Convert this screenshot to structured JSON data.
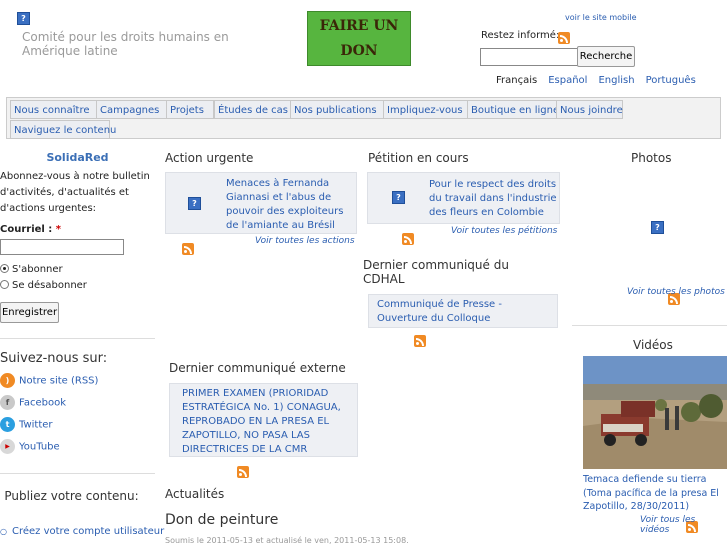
{
  "header": {
    "site_name": "Comité pour les droits humains en Amérique latine",
    "donate_line1": "FAIRE UN",
    "donate_line2": "DON",
    "mobile_link": "voir le site mobile",
    "inform_label": "Restez informé:",
    "search_button": "Recherche",
    "languages": [
      "Français",
      "Español",
      "English",
      "Português"
    ]
  },
  "nav": [
    "Nous connaître",
    "Campagnes",
    "Projets",
    "Études de cas",
    "Nos publications",
    "Impliquez-vous",
    "Boutique en ligne",
    "Nous joindre",
    "Naviguez le contenu"
  ],
  "left": {
    "title": "SolidaRed",
    "intro": "Abonnez-vous à notre bulletin d'activités, d'actualités et d'actions urgentes:",
    "email_label": "Courriel :",
    "required_mark": "*",
    "subscribe": "S'abonner",
    "unsubscribe": "Se désabonner",
    "register": "Enregistrer",
    "follow_title": "Suivez-nous sur:",
    "social": [
      "Notre site (RSS)",
      "Facebook",
      "Twitter",
      "YouTube"
    ],
    "publish_title": "Publiez votre contenu:",
    "publish_item": "Créez votre compte utilisateur"
  },
  "urgent": {
    "title": "Action urgente",
    "item": "Menaces à Fernanda Giannasi et l'abus de pouvoir des exploiteurs de l'amiante au Brésil",
    "see_all": "Voir toutes les actions"
  },
  "petition": {
    "title": "Pétition en cours",
    "item": "Pour le respect des droits du travail dans l'industrie des fleurs en Colombie",
    "see_all": "Voir toutes les pétitions"
  },
  "cdhal": {
    "title": "Dernier communiqué du CDHAL",
    "item": "Communiqué de Presse - Ouverture du Colloque"
  },
  "external": {
    "title": "Dernier communiqué externe",
    "item": "PRIMER EXAMEN (PRIORIDAD ESTRATÉGICA No. 1) CONAGUA, REPROBADO EN LA PRESA EL ZAPOTILLO, NO PASA LAS DIRECTRICES DE LA CMR"
  },
  "news": {
    "title": "Actualités",
    "article_title": "Don de peinture",
    "meta": "Soumis le 2011-05-13 et actualisé le ven, 2011-05-13 15:08."
  },
  "photos": {
    "title": "Photos",
    "see_all": "Voir toutes les photos"
  },
  "videos": {
    "title": "Vidéos",
    "caption": "Temaca defiende su tierra (Toma pacífica de la presa El Zapotillo, 28/30/2011)",
    "see_all": "Voir tous les vidéos"
  },
  "colors": {
    "link": "#2a5db0",
    "rss": "#f08a24",
    "donate_bg": "#57b53f",
    "card_bg": "#eef0f4"
  },
  "icons": [
    "broken-image-icon",
    "rss-icon",
    "facebook-icon",
    "twitter-icon",
    "youtube-icon"
  ]
}
